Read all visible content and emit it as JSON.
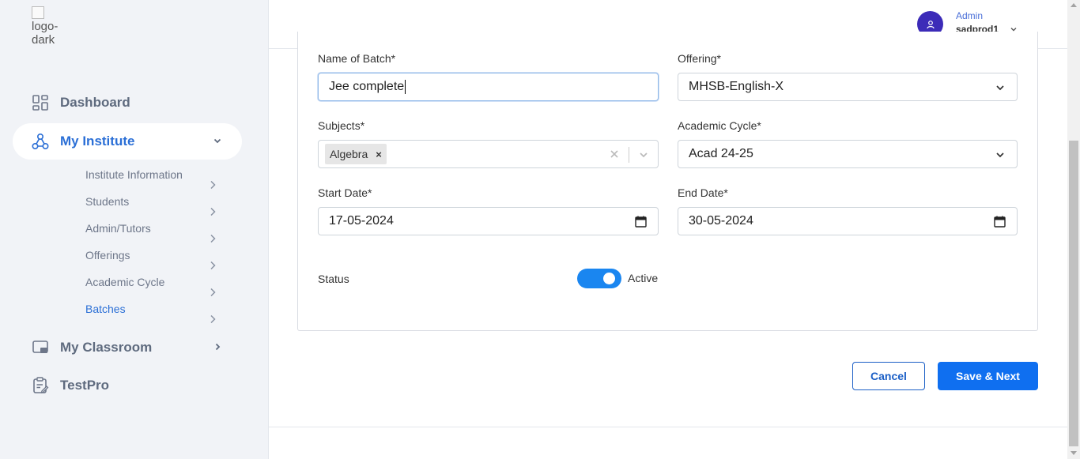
{
  "logo": {
    "alt_text": "logo-dark"
  },
  "sidebar": {
    "items": [
      {
        "label": "Dashboard",
        "icon": "dashboard-grid-icon"
      },
      {
        "label": "My Institute",
        "icon": "organization-icon",
        "expanded": true
      },
      {
        "label": "My Classroom",
        "icon": "classroom-icon"
      },
      {
        "label": "TestPro",
        "icon": "clipboard-icon"
      }
    ],
    "sub_items": [
      {
        "label": "Institute Information"
      },
      {
        "label": "Students"
      },
      {
        "label": "Admin/Tutors"
      },
      {
        "label": "Offerings"
      },
      {
        "label": "Academic Cycle"
      },
      {
        "label": "Batches",
        "active": true
      }
    ]
  },
  "header": {
    "user_role": "Admin",
    "user_name": "sadprod1"
  },
  "form": {
    "batch_name_label": "Name of Batch*",
    "batch_name_value": "Jee complete",
    "offering_label": "Offering*",
    "offering_value": "MHSB-English-X",
    "subjects_label": "Subjects*",
    "subjects_tags": [
      "Algebra"
    ],
    "tag_remove": "×",
    "academic_cycle_label": "Academic Cycle*",
    "academic_cycle_value": "Acad 24-25",
    "start_date_label": "Start Date*",
    "start_date_value": "17-05-2024",
    "end_date_label": "End Date*",
    "end_date_value": "30-05-2024",
    "status_label": "Status",
    "status_value": "Active",
    "status_on": true
  },
  "actions": {
    "cancel_label": "Cancel",
    "save_label": "Save & Next"
  },
  "colors": {
    "accent": "#0f6ff0",
    "sidebar_bg": "#f1f3f7",
    "active_text": "#2b6fd6",
    "avatar_bg": "#3c2bb8"
  }
}
